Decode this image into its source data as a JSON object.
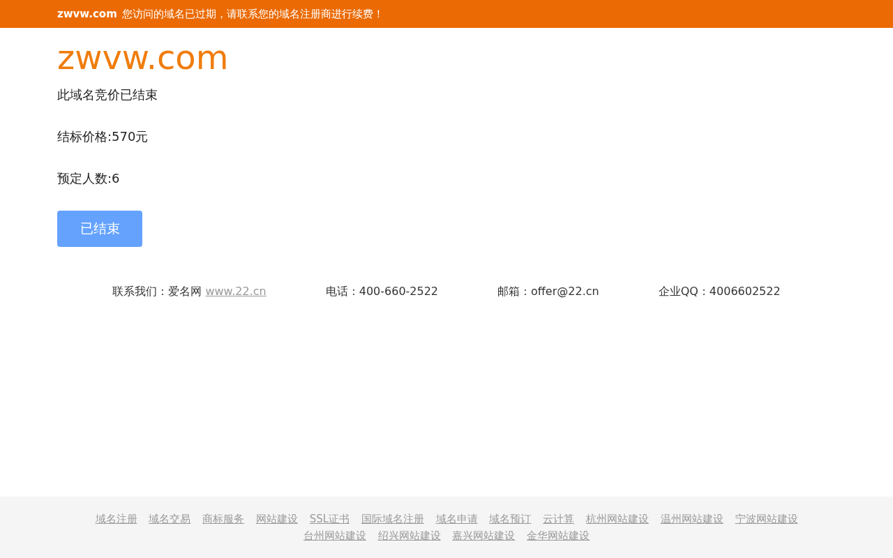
{
  "notice_bar": {
    "domain": "zwvw.com",
    "message": "您访问的域名已过期，请联系您的域名注册商进行续费！"
  },
  "domain_title": "zwvw.com",
  "status": "此域名竞价已结束",
  "final_price": "结标价格:570元",
  "reservations": "预定人数:6",
  "ended_button": {
    "label": "已结束",
    "disabled": true
  },
  "contact": {
    "label": "联系我们：爱名网",
    "link": "www.22.cn",
    "phone": "电话：400-660-2522",
    "email": "邮箱：offer@22.cn",
    "qq": "企业QQ：4006602522"
  },
  "footer_links": [
    "域名注册",
    "域名交易",
    "商标服务",
    "网站建设",
    "SSL证书",
    "国际域名注册",
    "域名申请",
    "域名预订",
    "云计算",
    "杭州网站建设",
    "温州网站建设",
    "宁波网站建设",
    "台州网站建设",
    "绍兴网站建设",
    "嘉兴网站建设",
    "金华网站建设"
  ]
}
